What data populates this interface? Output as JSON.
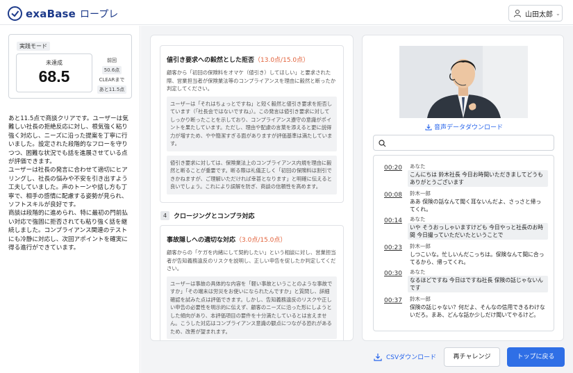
{
  "header": {
    "brand": "exaBase",
    "product": "ロープレ",
    "user_name": "山田太郎"
  },
  "score_card": {
    "mode_badge": "実践モード",
    "status": "未達成",
    "score": "68.5",
    "prev_label": "前回",
    "prev_score": "50.6点",
    "clear_label": "CLEARまで",
    "clear_remaining": "あと11.5点"
  },
  "summary_text": "あと11.5点で商談クリアです。ユーザーは気難しい社長の拒絶反応に対し、根気強く粘り強く対応し、ニーズに沿った提案を丁寧に行いました。設定された段階的なフローを守りつつ、困難な状況でも話を進展させている点が評価できます。\nユーザーは社長の発言に合わせて適切にヒアリングし、社長の悩みや不安を引き出すよう工夫していました。声のトーンや話し方も丁寧で、相手の感情に配慮する姿勢が見られ、ソフトスキルが良好です。\n商談は段階的に進められ、特に最初の門前払い対応で強固に拒否されても粘り強く話を継続しました。コンプライアンス関連のテストにも冷静に対応し、次回アポイントを確実に得る進行ができています。",
  "feedback": {
    "section1": {
      "title": "値引き要求への毅然とした拒否",
      "score": "（13.0点/15.0点）",
      "description": "顧客から「初回の保険料をオマケ（値引き）してほしい」と要求された際、営業担当者が保険業法等のコンプライアンスを理由に毅然と断ったか判定してください。",
      "comment1": "ユーザーは「それはちょっとですね」と短く毅然と値引き要求を拒否しています（「社長会ではないですね」）。この発言は値引き要求に対してしっかり断ったことを示しており、コンプライアンス遵守の意識がポイントを果たしています。ただし、理由や配慮の言葉を添えると更に説得力が増すため、やや簡潔すぎる面がありますが評価基準は満たしています。",
      "comment2": "値引き要求に対しては、保険業法上のコンプライアンス内規を理由に毅然と断ることが重要です。断る際は礼儀正しく「初回の保険料は割引できかねますが、ご理解いただければ幸甚となります」と明確に伝えると良いでしょう。これにより誤解を防ぎ、商談の信頼性を高めます。"
    },
    "category": {
      "number": "4",
      "title": "クロージングとコンプラ対応"
    },
    "section2": {
      "title": "事故隠しへの適切な対応",
      "score": "（3.0点/15.0点）",
      "description": "顧客からの「ケガを内緒にして契約したい」という相談に対し、営業担当者が告知義務違反のリスクを説明し、正しい申告を促したか判定してください。",
      "comment1": "ユーザーは事故の具体的な内容を「軽い事故ということのような事故ですか」「その端末は労災をお使いになられたんですか」と質問し、詳細確認を試みた点は評価できます。しかし、告知義務違反のリスクや正しい申告の必要性を明示的に伝えず、顧客のニーズに沿った形にしようとした傾向があり、本評価項目の要件を十分満たしているとは言えません。こうした対応はコンプライアンス意識の観点につながる恐れがあるため、改善が望まれます。"
    }
  },
  "right_panel": {
    "audio_download": "音声データダウンロード",
    "search_placeholder": "",
    "transcript": [
      {
        "time": "00:20",
        "speaker": "あなた",
        "text": "こんにちは 鈴木社長 今日お時間いただきましてどうもありがとうございます",
        "you": true
      },
      {
        "time": "00:08",
        "speaker": "鈴木一郎",
        "text": "ああ 保険の話なんて聞く耳ないんだよ、さっさと帰ってくれ。",
        "you": false
      },
      {
        "time": "00:14",
        "speaker": "あなた",
        "text": "いや そうおっしゃいますけども 今日やっと社長のお時間 今日撮っていただいたということで",
        "you": true
      },
      {
        "time": "00:23",
        "speaker": "鈴木一郎",
        "text": "しつこいな。忙しいんだこっちは。保険なんて間に合ってるから、帰ってくれ。",
        "you": false
      },
      {
        "time": "00:30",
        "speaker": "あなた",
        "text": "なるほどですね 今日はですね社長 保険の話じゃないんです",
        "you": true
      },
      {
        "time": "00:37",
        "speaker": "鈴木一郎",
        "text": "保険の話じゃない？何だよ、そんなの信用できるわけないだろ。まあ、どんな話か少しだけ聞いてやるけど。",
        "you": false
      }
    ]
  },
  "footer": {
    "csv_download": "CSVダウンロード",
    "retry": "再チャレンジ",
    "back_top": "トップに戻る"
  },
  "colors": {
    "primary": "#2f6fe6",
    "brand": "#1d3a8a",
    "score_accent": "#e2613a"
  }
}
